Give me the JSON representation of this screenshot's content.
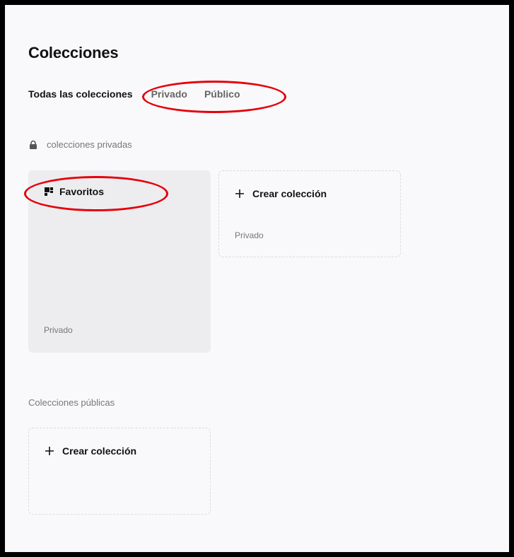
{
  "page": {
    "title": "Colecciones"
  },
  "tabs": [
    {
      "label": "Todas las colecciones"
    },
    {
      "label": "Privado"
    },
    {
      "label": "Público"
    }
  ],
  "sections": {
    "private_label": "colecciones privadas",
    "public_label": "Colecciones públicas"
  },
  "cards": {
    "favorites": {
      "title": "Favoritos",
      "visibility": "Privado"
    },
    "create_private": {
      "label": "Crear colección",
      "visibility": "Privado"
    },
    "create_public": {
      "label": "Crear colección"
    }
  },
  "colors": {
    "background": "#f9f9fb",
    "card_fill": "#ededf0",
    "annotation": "#e5000a"
  }
}
